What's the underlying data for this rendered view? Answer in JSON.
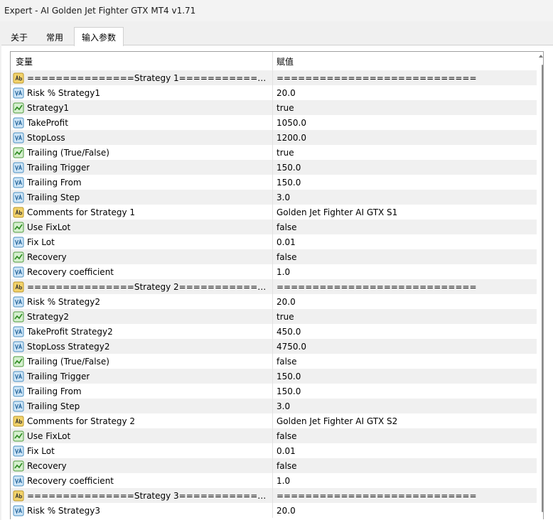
{
  "window": {
    "title": "Expert - AI Golden Jet Fighter GTX MT4 v1.71"
  },
  "tabs": [
    {
      "label": "关于"
    },
    {
      "label": "常用"
    },
    {
      "label": "输入参数",
      "active": true
    }
  ],
  "table": {
    "col_name": "变量",
    "col_value": "赋值",
    "rows": [
      {
        "icon": "ab",
        "name": "===============Strategy 1===============...",
        "value": "============================"
      },
      {
        "icon": "va",
        "name": "Risk % Strategy1",
        "value": "20.0"
      },
      {
        "icon": "bool",
        "name": "Strategy1",
        "value": "true"
      },
      {
        "icon": "va",
        "name": "TakeProfit",
        "value": "1050.0"
      },
      {
        "icon": "va",
        "name": "StopLoss",
        "value": "1200.0"
      },
      {
        "icon": "bool",
        "name": "Trailing (True/False)",
        "value": "true"
      },
      {
        "icon": "va",
        "name": "Trailing Trigger",
        "value": "150.0"
      },
      {
        "icon": "va",
        "name": "Trailing From",
        "value": "150.0"
      },
      {
        "icon": "va",
        "name": "Trailing Step",
        "value": "3.0"
      },
      {
        "icon": "ab",
        "name": "Comments for Strategy 1",
        "value": "Golden Jet Fighter AI GTX S1"
      },
      {
        "icon": "bool",
        "name": "Use FixLot",
        "value": "false"
      },
      {
        "icon": "va",
        "name": "Fix Lot",
        "value": "0.01"
      },
      {
        "icon": "bool",
        "name": "Recovery",
        "value": "false"
      },
      {
        "icon": "va",
        "name": "Recovery coefficient",
        "value": "1.0"
      },
      {
        "icon": "ab",
        "name": "===============Strategy 2===============...",
        "value": "============================"
      },
      {
        "icon": "va",
        "name": "Risk % Strategy2",
        "value": "20.0"
      },
      {
        "icon": "bool",
        "name": "Strategy2",
        "value": "true"
      },
      {
        "icon": "va",
        "name": "TakeProfit Strategy2",
        "value": "450.0"
      },
      {
        "icon": "va",
        "name": "StopLoss Strategy2",
        "value": "4750.0"
      },
      {
        "icon": "bool",
        "name": "Trailing (True/False)",
        "value": "false"
      },
      {
        "icon": "va",
        "name": "Trailing Trigger",
        "value": "150.0"
      },
      {
        "icon": "va",
        "name": "Trailing From",
        "value": "150.0"
      },
      {
        "icon": "va",
        "name": "Trailing Step",
        "value": "3.0"
      },
      {
        "icon": "ab",
        "name": "Comments for Strategy 2",
        "value": "Golden Jet Fighter AI GTX S2"
      },
      {
        "icon": "bool",
        "name": "Use FixLot",
        "value": "false"
      },
      {
        "icon": "va",
        "name": "Fix Lot",
        "value": "0.01"
      },
      {
        "icon": "bool",
        "name": "Recovery",
        "value": "false"
      },
      {
        "icon": "va",
        "name": "Recovery coefficient",
        "value": "1.0"
      },
      {
        "icon": "ab",
        "name": "===============Strategy 3===============...",
        "value": "============================"
      },
      {
        "icon": "va",
        "name": "Risk % Strategy3",
        "value": "20.0"
      }
    ]
  },
  "icons": {
    "ab": "string-param-icon",
    "va": "numeric-param-icon",
    "bool": "boolean-param-icon"
  },
  "colors": {
    "ab_fill": "#f3d36b",
    "va_fill": "#cfe6f7",
    "bool_fill": "#d6f0cf"
  }
}
